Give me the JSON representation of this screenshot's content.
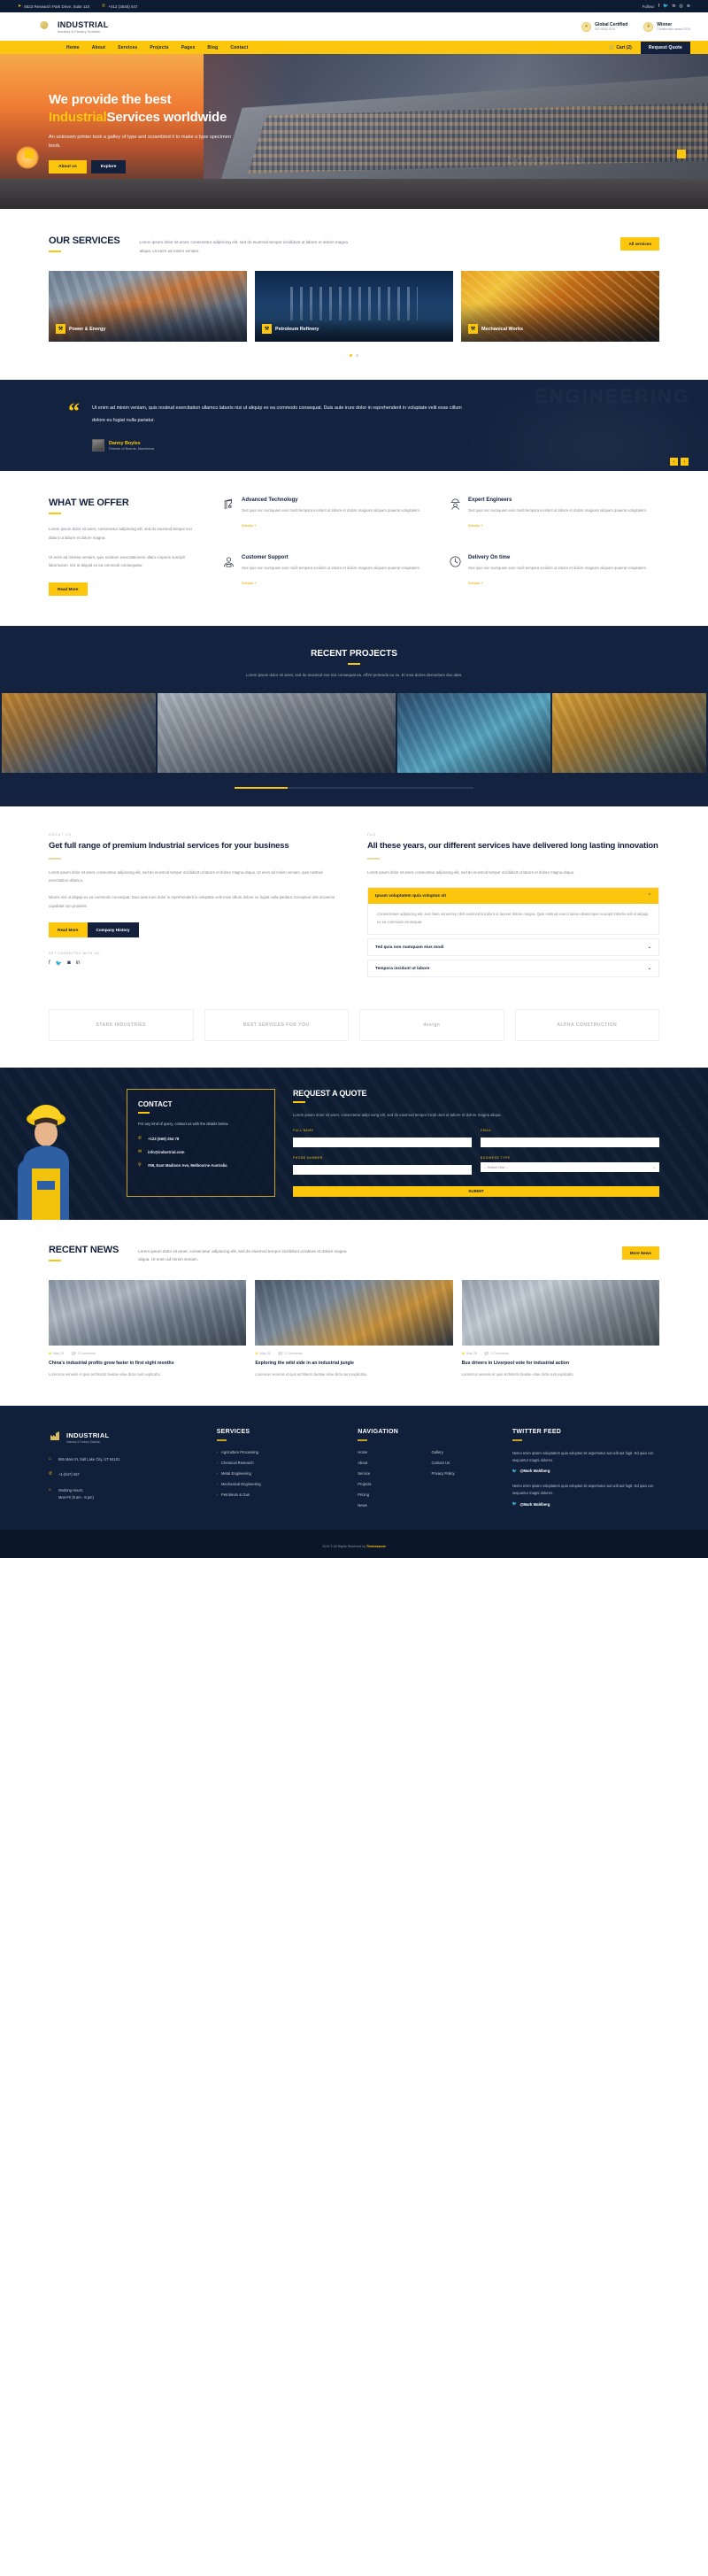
{
  "topbar": {
    "address": "5523 Research Park Drive, Suite 110",
    "phone": "+012 (3546) 547",
    "follow_label": "Follow:",
    "socials": [
      "facebook-icon",
      "twitter-icon",
      "linkedin-icon",
      "instagram-icon",
      "rss-icon"
    ]
  },
  "header": {
    "logo_name": "INDUSTRIAL",
    "logo_tagline": "Industry & Factory Solution",
    "certs": [
      {
        "title": "Global Certified",
        "sub": "ISO 9001:2015"
      },
      {
        "title": "Winner",
        "sub": "Construction award 2019"
      }
    ]
  },
  "nav": {
    "items": [
      "Home",
      "About",
      "Services",
      "Projects",
      "Pages",
      "Blog",
      "Contact"
    ],
    "cart_label": "Cart (2)",
    "quote_button": "Request Quote"
  },
  "hero": {
    "title_line1": "We provide the best",
    "title_accent": "Industrial",
    "title_line2": "Services worldwide",
    "paragraph": "An unknown printer took a galley of type and scrambled it to make a type specimen book.",
    "btn_primary": "About us",
    "btn_secondary": "Explore",
    "watermark": "boilesteamb"
  },
  "services": {
    "title": "OUR SERVICES",
    "desc": "Lorem ipsum dolor sit amet, consectetur adipiscing elit, sed do eiusmod tempor incididunt ut labore et dolore magna aliqua. Ut enim ad minim veniam.",
    "button": "All services",
    "cards": [
      {
        "name": "Power & Energy"
      },
      {
        "name": "Petroleum Refinery"
      },
      {
        "name": "Mechanical Works"
      }
    ]
  },
  "testimonial": {
    "quote": "Ut enim ad minim veniam, quis nostrud exercitation ullamco laboris nisi ut aliquip ex ea commodo consequat. Duis aute irure dolor in reprehenderit in voluptate velit esse cillum dolore eu fugiat nulla pariatur.",
    "author": "Danny Boyles",
    "role": "Director of Boards, Machinima",
    "prev": "‹",
    "next": "›"
  },
  "offer": {
    "title": "WHAT WE OFFER",
    "p1": "Lorem ipsum dolor sit amet, consectetur adipiscing elit, sed do eiusmod tempor inci didunt ut labore et dolore magna.",
    "p2": "Ut enim ad minima veniam, quis nostrum exercitationem ullam corporis suscipit laboriosam, nisi ut aliquid ex ea commodi consequatur.",
    "button": "Read More",
    "features": [
      {
        "icon": "crane-icon",
        "title": "Advanced Technology",
        "text": "Sed quia non numquam eius modi tempora incidunt ut labore et dolore magnam aliquam quaerat voluptatem.",
        "link": "Details +"
      },
      {
        "icon": "engineer-icon",
        "title": "Expert Engineers",
        "text": "Sed quia non numquam eius modi tempora incidunt ut labore et dolore magnam aliquam quaerat voluptatem.",
        "link": "Details +"
      },
      {
        "icon": "support-icon",
        "title": "Customer Support",
        "text": "Sed quia non numquam eius modi tempora incidunt ut labore et dolore magnam aliquam quaerat voluptatem.",
        "link": "Details +"
      },
      {
        "icon": "clock-icon",
        "title": "Delivery On time",
        "text": "Sed quia non numquam eius modi tempora incidunt ut labore et dolore magnam aliquam quaerat voluptatem.",
        "link": "Details +"
      }
    ]
  },
  "projects": {
    "title": "RECENT PROJECTS",
    "desc": "Lorem ipsum dolor sit amet, sed do eiusmod eos nisi consequat ea. Affert pertendo eu eu. Ei mea dolore demoritum duo alия."
  },
  "about": {
    "left": {
      "eyebrow": "ABOUT US",
      "heading": "Get full range of premium Industrial services for your business",
      "p1": "Lorem ipsum dolor sit amet, consectetur adipiscing elit, sed do eiusmod tempor incididunt ut labore et dolore magna aliqua. Ut enim ad minim veniam, quis nostrud exercitation ullamco.",
      "p2": "laboris nisi ut aliquip ex ea commodo consequat. Duis aute irure dolor in reprehenderit in voluptate velit esse cillum dolore eu fugiat nulla pariatur. Excepteur sint occaecat cupidatat non proident.",
      "btn1": "Read More",
      "btn2": "Company History",
      "connect": "GET CONNECTED WITH US:",
      "socials": [
        "facebook-icon",
        "twitter-icon",
        "instagram-icon",
        "linkedin-icon"
      ]
    },
    "right": {
      "eyebrow": "FAQ",
      "heading": "All these years, our different services have delivered long lasting innovation",
      "p1": "Lorem ipsum dolor sit amet, consectetur adipiscing elit, sed do eiusmod tempor incididunt ut labore et dolore magna aliqua.",
      "accordion": [
        {
          "q": "Ipsam voluptatem quia voluptas sit",
          "open": true,
          "a": "Consectetuer adipiscing elit, sed diam nonummy nibh euismod tincidunt ut laoreet dolore magna. Quis nostrud exerci tation ullamcorper suscipit lobortis nisl ut aliquip ex ea commodo consequat."
        },
        {
          "q": "Ted quia non numquam eius modi",
          "open": false,
          "a": ""
        },
        {
          "q": "Tempora incidunt ut labore",
          "open": false,
          "a": ""
        }
      ]
    }
  },
  "brands": [
    "STARK INDUSTRIES",
    "BEST SERVICES FOR YOU",
    "design",
    "ALPHA CONSTRUCTION"
  ],
  "contact": {
    "title": "CONTACT",
    "desc": "For any kind of query, contact us with the details below.",
    "phone": "+123 (569) 254 78",
    "email": "info@industrial.com",
    "address": "#59, East Madison Ave, Melbourne Australia"
  },
  "quote": {
    "title": "REQUEST A QUOTE",
    "desc": "Lorem ipsum dolor sit amet, consectetur adipi song elit, sed do eiusmod tempor incidi dunt ut labore et dolore magna aliqua.",
    "fields": [
      {
        "label": "FULL NAME",
        "type": "input",
        "value": ""
      },
      {
        "label": "EMAIL",
        "type": "input",
        "value": ""
      },
      {
        "label": "PHONE NUMBER",
        "type": "input",
        "value": ""
      },
      {
        "label": "BUSINESS TYPE",
        "type": "select",
        "value": "-- Select One --"
      }
    ],
    "submit": "SUBMIT"
  },
  "news": {
    "title": "RECENT NEWS",
    "desc": "Lorem ipsum dolor sit amet, consectetur adipiscing elit, sed do eiusmod tempor incididunt ut labore et dolore magna aliqua. Ut enim ad minim veniam.",
    "button": "More News",
    "posts": [
      {
        "date": "May 25",
        "comments": "2 Comments",
        "title": "China's industrial profits grow faster in first eight months",
        "excerpt": "Loremcus venenis et quis architecto beatae vitae dicta sunt explicabo."
      },
      {
        "date": "May 25",
        "comments": "2 Comments",
        "title": "Exploring the wild side in an industrial jungle",
        "excerpt": "Loremcus venenis et quis architecto beatae vitae dicta sunt explicabo."
      },
      {
        "date": "May 25",
        "comments": "2 Comments",
        "title": "Bus drivers in Liverpool vote for industrial action",
        "excerpt": "Loremcus venenis et quis architecto beatae vitae dicta sunt explicabo."
      }
    ]
  },
  "footer": {
    "logo_name": "INDUSTRIAL",
    "logo_tagline": "Industry & Factory Solution",
    "address": "555 Main St, Salt Lake City, UT 84101",
    "phone": "+1-(547)-257",
    "hours_label": "Working Hours:",
    "hours": "Mon-Fri (9 am - 8 pm)",
    "services_title": "SERVICES",
    "services": [
      "Agriculture Processing",
      "Chemical Research",
      "Metal Engineering",
      "Mechanical Engineering",
      "Petroleum & Gas"
    ],
    "nav_title": "NAVIGATION",
    "nav": [
      "Home",
      "About",
      "Service",
      "Projects",
      "Pricing",
      "News",
      "Gallery",
      "Contact Us",
      "Privacy Policy"
    ],
    "twitter_title": "TWITTER FEED",
    "tweets": [
      {
        "text": "Nemo enim ipsam voluptatem quia voluptas sit aspernatur aut odit aut fugit. Ed quia con sequuntur magni dolores.",
        "handle": "@Mark Wahlberg"
      },
      {
        "text": "Nemo enim ipsam voluptatem quia voluptas sit aspernatur aut odit aut fugit. Ed quia con sequuntur magni dolores.",
        "handle": "@Mark Wahlberg"
      }
    ]
  },
  "copyright": {
    "text": "2019 © All Rights Reserved by ",
    "brand": "Themeszone"
  }
}
